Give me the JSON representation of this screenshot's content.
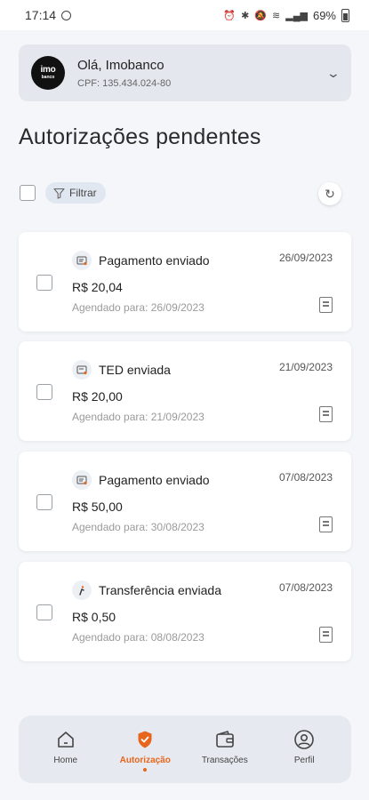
{
  "status_bar": {
    "time": "17:14",
    "battery": "69%"
  },
  "account": {
    "greeting": "Olá, Imobanco",
    "cpf": "CPF: 135.434.024-80",
    "logo_text": "imo",
    "logo_sub": "banco"
  },
  "page": {
    "title": "Autorizações pendentes"
  },
  "filter": {
    "label": "Filtrar"
  },
  "cards": [
    {
      "icon": "payment-icon",
      "type": "Pagamento enviado",
      "date": "26/09/2023",
      "amount": "R$ 20,04",
      "scheduled": "Agendado para: 26/09/2023"
    },
    {
      "icon": "ted-icon",
      "type": "TED enviada",
      "date": "21/09/2023",
      "amount": "R$ 20,00",
      "scheduled": "Agendado para: 21/09/2023"
    },
    {
      "icon": "payment-icon",
      "type": "Pagamento enviado",
      "date": "07/08/2023",
      "amount": "R$ 50,00",
      "scheduled": "Agendado para: 30/08/2023"
    },
    {
      "icon": "transfer-icon",
      "type": "Transferência enviada",
      "date": "07/08/2023",
      "amount": "R$ 0,50",
      "scheduled": "Agendado para: 08/08/2023"
    }
  ],
  "nav": {
    "items": [
      {
        "label": "Home",
        "icon": "home-icon"
      },
      {
        "label": "Autorização",
        "icon": "shield-check-icon"
      },
      {
        "label": "Transações",
        "icon": "wallet-icon"
      },
      {
        "label": "Perfil",
        "icon": "user-icon"
      }
    ],
    "active_index": 1
  },
  "colors": {
    "accent": "#e8651c",
    "background": "#f4f6fa",
    "card": "#ffffff"
  }
}
